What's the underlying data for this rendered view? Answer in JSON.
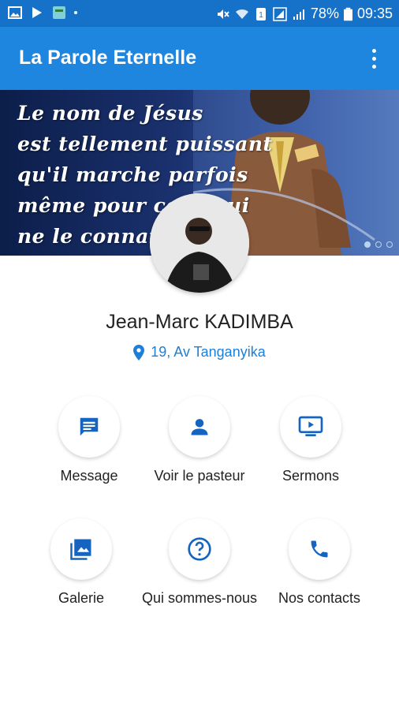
{
  "status_bar": {
    "battery": "78%",
    "time": "09:35"
  },
  "app": {
    "title": "La Parole Eternelle"
  },
  "banner": {
    "quote_lines": [
      "Le nom de Jésus",
      "est tellement puissant",
      "qu'il marche parfois",
      "même pour ceux qui",
      "ne le connaissent"
    ]
  },
  "profile": {
    "name": "Jean-Marc KADIMBA",
    "address": "19, Av Tanganyika"
  },
  "actions": [
    {
      "label": "Message",
      "icon": "message-icon"
    },
    {
      "label": "Voir le pasteur",
      "icon": "person-icon"
    },
    {
      "label": "Sermons",
      "icon": "video-icon"
    },
    {
      "label": "Galerie",
      "icon": "gallery-icon"
    },
    {
      "label": "Qui sommes-nous",
      "icon": "question-icon"
    },
    {
      "label": "Nos contacts",
      "icon": "phone-icon"
    }
  ],
  "colors": {
    "status_bar": "#1671c9",
    "app_bar": "#1e86df",
    "accent": "#1e7fd6",
    "icon": "#1565c0"
  }
}
